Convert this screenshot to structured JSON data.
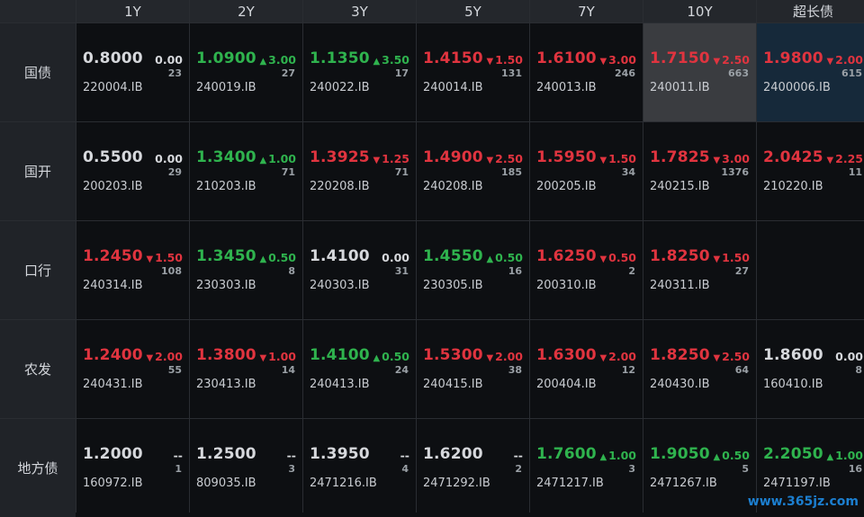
{
  "columns": [
    "1Y",
    "2Y",
    "3Y",
    "5Y",
    "7Y",
    "10Y",
    "超长债"
  ],
  "rows": [
    {
      "label": "国债",
      "cells": [
        {
          "price": "0.8000",
          "change": "0.00",
          "dir": "flat",
          "volume": "23",
          "code": "220004.IB"
        },
        {
          "price": "1.0900",
          "change": "3.00",
          "dir": "up",
          "volume": "27",
          "code": "240019.IB"
        },
        {
          "price": "1.1350",
          "change": "3.50",
          "dir": "up",
          "volume": "17",
          "code": "240022.IB"
        },
        {
          "price": "1.4150",
          "change": "1.50",
          "dir": "down",
          "volume": "131",
          "code": "240014.IB"
        },
        {
          "price": "1.6100",
          "change": "3.00",
          "dir": "down",
          "volume": "246",
          "code": "240013.IB"
        },
        {
          "price": "1.7150",
          "change": "2.50",
          "dir": "down",
          "volume": "663",
          "code": "240011.IB",
          "highlight": "grey"
        },
        {
          "price": "1.9800",
          "change": "2.00",
          "dir": "down",
          "volume": "615",
          "code": "2400006.IB",
          "highlight": "teal"
        }
      ]
    },
    {
      "label": "国开",
      "cells": [
        {
          "price": "0.5500",
          "change": "0.00",
          "dir": "flat",
          "volume": "29",
          "code": "200203.IB"
        },
        {
          "price": "1.3400",
          "change": "1.00",
          "dir": "up",
          "volume": "71",
          "code": "210203.IB"
        },
        {
          "price": "1.3925",
          "change": "1.25",
          "dir": "down",
          "volume": "71",
          "code": "220208.IB"
        },
        {
          "price": "1.4900",
          "change": "2.50",
          "dir": "down",
          "volume": "185",
          "code": "240208.IB"
        },
        {
          "price": "1.5950",
          "change": "1.50",
          "dir": "down",
          "volume": "34",
          "code": "200205.IB"
        },
        {
          "price": "1.7825",
          "change": "3.00",
          "dir": "down",
          "volume": "1376",
          "code": "240215.IB"
        },
        {
          "price": "2.0425",
          "change": "2.25",
          "dir": "down",
          "volume": "11",
          "code": "210220.IB"
        }
      ]
    },
    {
      "label": "口行",
      "cells": [
        {
          "price": "1.2450",
          "change": "1.50",
          "dir": "down",
          "volume": "108",
          "code": "240314.IB"
        },
        {
          "price": "1.3450",
          "change": "0.50",
          "dir": "up",
          "volume": "8",
          "code": "230303.IB"
        },
        {
          "price": "1.4100",
          "change": "0.00",
          "dir": "flat",
          "volume": "31",
          "code": "240303.IB"
        },
        {
          "price": "1.4550",
          "change": "0.50",
          "dir": "up",
          "volume": "16",
          "code": "230305.IB"
        },
        {
          "price": "1.6250",
          "change": "0.50",
          "dir": "down",
          "volume": "2",
          "code": "200310.IB"
        },
        {
          "price": "1.8250",
          "change": "1.50",
          "dir": "down",
          "volume": "27",
          "code": "240311.IB"
        },
        null
      ]
    },
    {
      "label": "农发",
      "cells": [
        {
          "price": "1.2400",
          "change": "2.00",
          "dir": "down",
          "volume": "55",
          "code": "240431.IB"
        },
        {
          "price": "1.3800",
          "change": "1.00",
          "dir": "down",
          "volume": "14",
          "code": "230413.IB"
        },
        {
          "price": "1.4100",
          "change": "0.50",
          "dir": "up",
          "volume": "24",
          "code": "240413.IB"
        },
        {
          "price": "1.5300",
          "change": "2.00",
          "dir": "down",
          "volume": "38",
          "code": "240415.IB"
        },
        {
          "price": "1.6300",
          "change": "2.00",
          "dir": "down",
          "volume": "12",
          "code": "200404.IB"
        },
        {
          "price": "1.8250",
          "change": "2.50",
          "dir": "down",
          "volume": "64",
          "code": "240430.IB"
        },
        {
          "price": "1.8600",
          "change": "0.00",
          "dir": "flat",
          "volume": "8",
          "code": "160410.IB"
        }
      ]
    },
    {
      "label": "地方债",
      "cells": [
        {
          "price": "1.2000",
          "change": "--",
          "dir": "flat",
          "volume": "1",
          "code": "160972.IB"
        },
        {
          "price": "1.2500",
          "change": "--",
          "dir": "flat",
          "volume": "3",
          "code": "809035.IB"
        },
        {
          "price": "1.3950",
          "change": "--",
          "dir": "flat",
          "volume": "4",
          "code": "2471216.IB"
        },
        {
          "price": "1.6200",
          "change": "--",
          "dir": "flat",
          "volume": "2",
          "code": "2471292.IB"
        },
        {
          "price": "1.7600",
          "change": "1.00",
          "dir": "up",
          "volume": "3",
          "code": "2471217.IB"
        },
        {
          "price": "1.9050",
          "change": "0.50",
          "dir": "up",
          "volume": "5",
          "code": "2471267.IB"
        },
        {
          "price": "2.2050",
          "change": "1.00",
          "dir": "up",
          "volume": "16",
          "code": "2471197.IB"
        }
      ]
    }
  ],
  "colors": {
    "up": "#2fb34e",
    "down": "#e0343f",
    "flat": "#d6d8dc"
  },
  "icons": {
    "up": "triangle-up-icon",
    "down": "triangle-down-icon"
  },
  "watermark": "www.365jz.com"
}
